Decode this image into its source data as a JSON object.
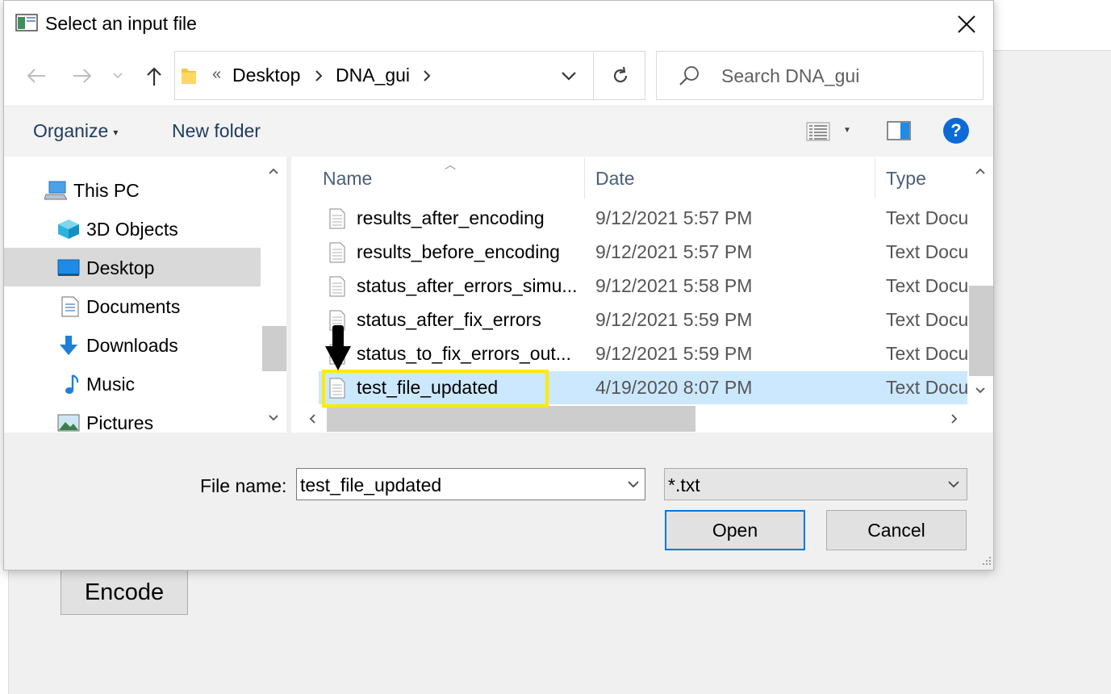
{
  "dialog": {
    "title": "Select an input file",
    "close_icon": "close-icon"
  },
  "address": {
    "overflow": "«",
    "crumbs": [
      "Desktop",
      "DNA_gui"
    ]
  },
  "search": {
    "placeholder": "Search DNA_gui"
  },
  "toolbar": {
    "organize_label": "Organize",
    "new_folder_label": "New folder",
    "help_label": "?"
  },
  "nav": {
    "items": [
      {
        "label": "This PC",
        "icon": "computer-icon"
      },
      {
        "label": "3D Objects",
        "icon": "cube-icon"
      },
      {
        "label": "Desktop",
        "icon": "desktop-icon",
        "selected": true
      },
      {
        "label": "Documents",
        "icon": "document-icon"
      },
      {
        "label": "Downloads",
        "icon": "download-arrow-icon"
      },
      {
        "label": "Music",
        "icon": "music-note-icon"
      },
      {
        "label": "Pictures",
        "icon": "picture-icon"
      }
    ]
  },
  "files": {
    "columns": [
      "Name",
      "Date",
      "Type"
    ],
    "rows": [
      {
        "name": "results_after_encoding",
        "date": "9/12/2021 5:57 PM",
        "type": "Text Document"
      },
      {
        "name": "results_before_encoding",
        "date": "9/12/2021 5:57 PM",
        "type": "Text Document"
      },
      {
        "name": "status_after_errors_simu...",
        "date": "9/12/2021 5:58 PM",
        "type": "Text Document"
      },
      {
        "name": "status_after_fix_errors",
        "date": "9/12/2021 5:59 PM",
        "type": "Text Document"
      },
      {
        "name": "status_to_fix_errors_out...",
        "date": "9/12/2021 5:59 PM",
        "type": "Text Document"
      },
      {
        "name": "test_file_updated",
        "date": "4/19/2020 8:07 PM",
        "type": "Text Document",
        "selected": true
      }
    ]
  },
  "bottom": {
    "file_name_label": "File name:",
    "file_name_value": "test_file_updated",
    "file_type_value": "*.txt",
    "open_label": "Open",
    "cancel_label": "Cancel"
  },
  "background_app": {
    "encode_label": "Encode"
  },
  "colors": {
    "accent": "#0078d7",
    "selection": "#cce8ff",
    "highlight": "#ffea00"
  }
}
